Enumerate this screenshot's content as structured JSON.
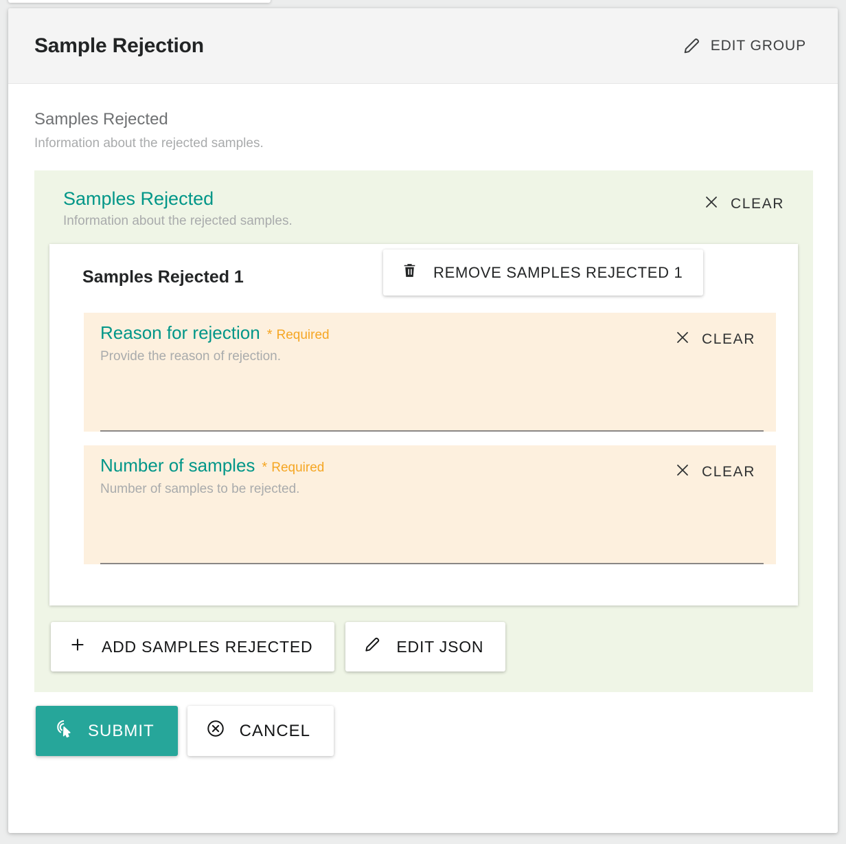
{
  "window": {
    "card_title": "Sample Rejection"
  },
  "header": {
    "edit_group_label": "EDIT GROUP",
    "edit_group_icon": "pencil-icon"
  },
  "group": {
    "title": "Samples Rejected",
    "description": "Information about the rejected samples."
  },
  "panel": {
    "title": "Samples Rejected",
    "description": "Information about the rejected samples.",
    "clear_label": "CLEAR",
    "clear_icon": "close-icon",
    "background_color": "#eff5e6",
    "accent_color": "#009688"
  },
  "item": {
    "title": "Samples Rejected 1",
    "remove_label": "REMOVE SAMPLES REJECTED 1",
    "remove_icon": "trash-icon"
  },
  "fields": [
    {
      "label": "Reason for rejection",
      "required_star": "*",
      "required_text": "Required",
      "description": "Provide the reason of rejection.",
      "value": "",
      "placeholder": "",
      "clear_label": "CLEAR",
      "clear_icon": "close-icon"
    },
    {
      "label": "Number of samples",
      "required_star": "*",
      "required_text": "Required",
      "description": "Number of samples to be rejected.",
      "value": "",
      "placeholder": "",
      "clear_label": "CLEAR",
      "clear_icon": "close-icon"
    }
  ],
  "panel_actions": {
    "add_label": "ADD SAMPLES REJECTED",
    "add_icon": "plus-icon",
    "edit_json_label": "EDIT JSON",
    "edit_json_icon": "pencil-icon"
  },
  "form_actions": {
    "submit_label": "SUBMIT",
    "submit_icon": "touch-app-icon",
    "submit_color": "#26a69a",
    "cancel_label": "CANCEL",
    "cancel_icon": "cancel-circle-icon"
  },
  "colors": {
    "accent_teal": "#009688",
    "required_amber": "#f5a623",
    "panel_green": "#eff5e6",
    "field_peach": "#fdf0de",
    "header_gray": "#f4f4f4"
  }
}
